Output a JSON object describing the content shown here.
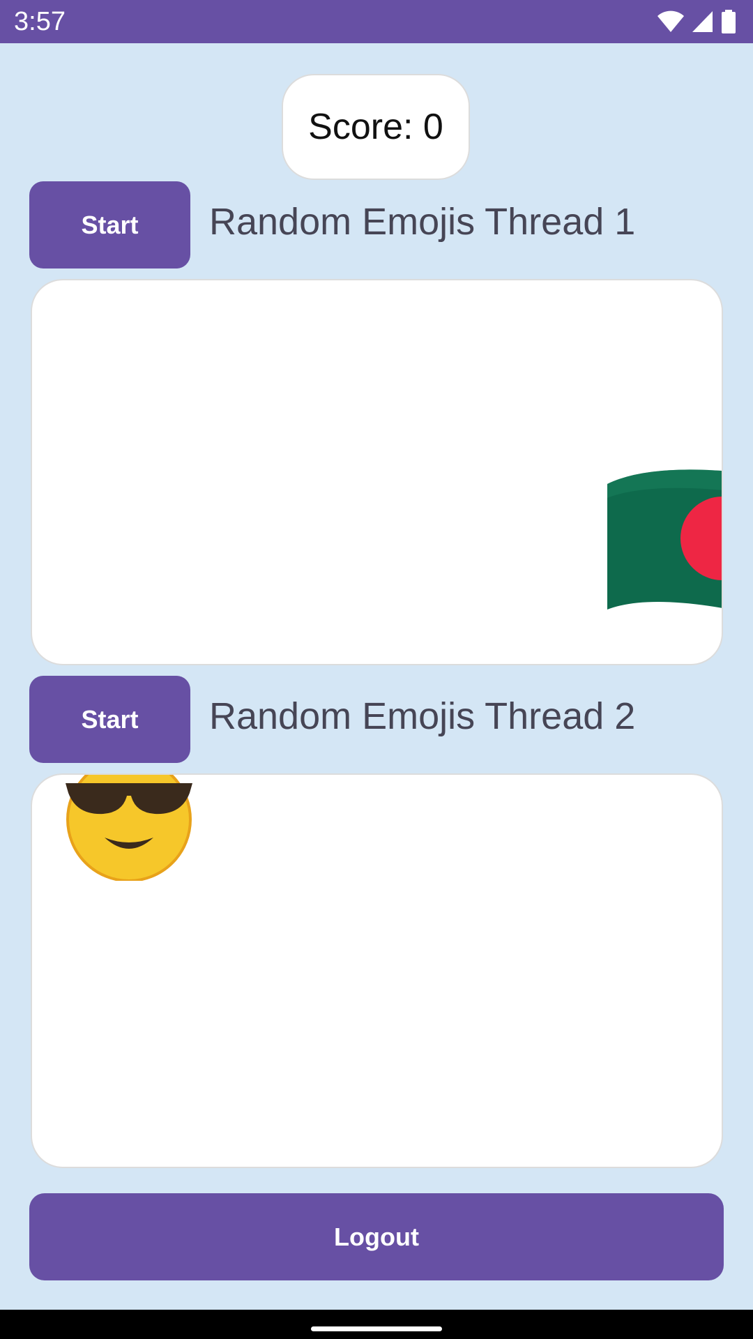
{
  "status_bar": {
    "time": "3:57",
    "icons": [
      "wifi-icon",
      "signal-icon",
      "battery-icon"
    ]
  },
  "score": {
    "text": "Score: 0"
  },
  "threads": [
    {
      "button_label": "Start",
      "title": "Random Emojis Thread 1",
      "emoji": "bangladesh-flag"
    },
    {
      "button_label": "Start",
      "title": "Random Emojis Thread 2",
      "emoji": "smiling-face-with-sunglasses"
    }
  ],
  "logout": {
    "label": "Logout"
  },
  "colors": {
    "primary": "#6750a4",
    "background": "#d4e6f5",
    "surface": "#ffffff",
    "label_text": "#464555"
  }
}
